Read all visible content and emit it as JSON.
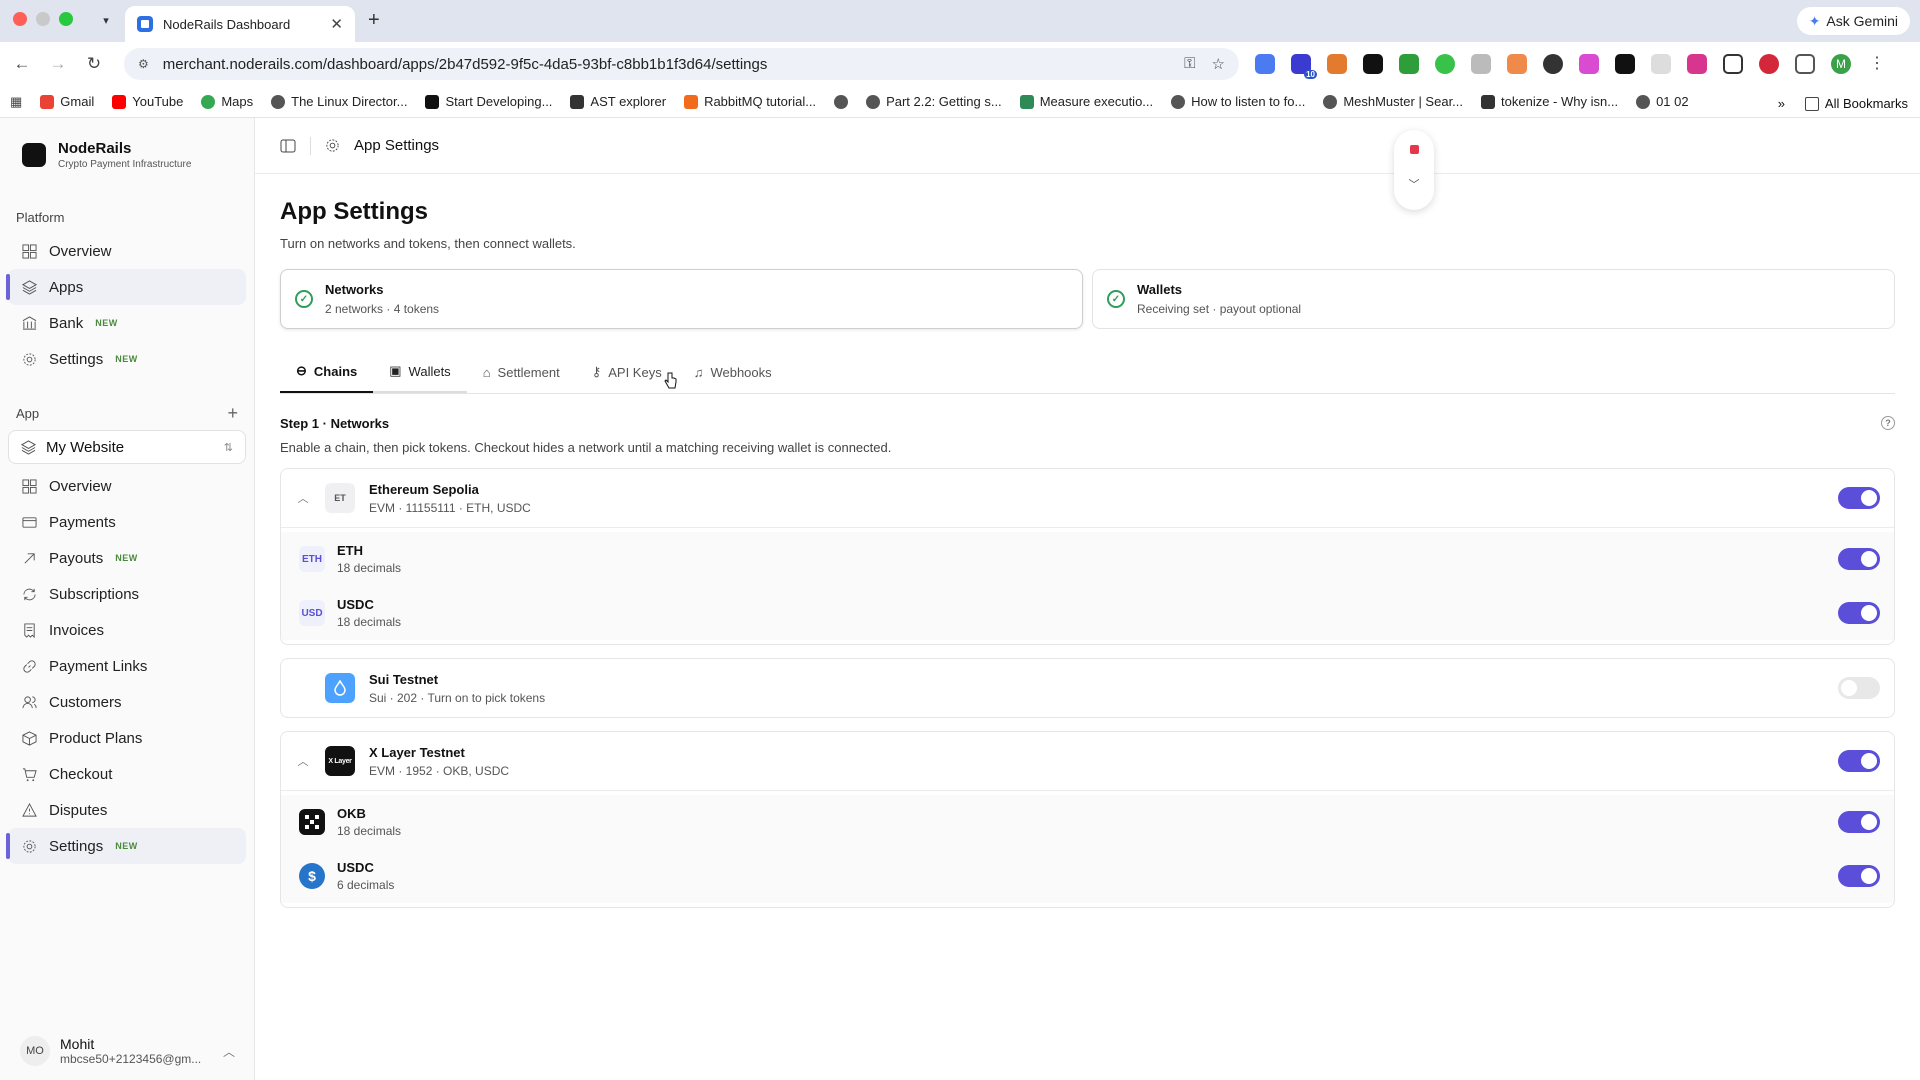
{
  "browser": {
    "tab_title": "NodeRails Dashboard",
    "url": "merchant.noderails.com/dashboard/apps/2b47d592-9f5c-4da5-93bf-c8bb1b1f3d64/settings",
    "ask_gemini": "Ask Gemini",
    "bookmarks": [
      "Gmail",
      "YouTube",
      "Maps",
      "The Linux Director...",
      "Start Developing...",
      "AST explorer",
      "RabbitMQ tutorial...",
      "",
      "Part 2.2: Getting s...",
      "Measure executio...",
      "How to listen to fo...",
      "MeshMuster | Sear...",
      "tokenize - Why isn...",
      "01 02"
    ],
    "all_bookmarks": "All Bookmarks",
    "more": "»",
    "ext_badge": "10",
    "profile": "M"
  },
  "sidebar": {
    "brand_name": "NodeRails",
    "brand_sub": "Crypto Payment Infrastructure",
    "platform_label": "Platform",
    "platform_items": [
      {
        "label": "Overview",
        "badge": ""
      },
      {
        "label": "Apps",
        "badge": ""
      },
      {
        "label": "Bank",
        "badge": "NEW"
      },
      {
        "label": "Settings",
        "badge": "NEW"
      }
    ],
    "app_label": "App",
    "app_add": "+",
    "app_selected": "My Website",
    "app_items": [
      {
        "label": "Overview",
        "badge": ""
      },
      {
        "label": "Payments",
        "badge": ""
      },
      {
        "label": "Payouts",
        "badge": "NEW"
      },
      {
        "label": "Subscriptions",
        "badge": ""
      },
      {
        "label": "Invoices",
        "badge": ""
      },
      {
        "label": "Payment Links",
        "badge": ""
      },
      {
        "label": "Customers",
        "badge": ""
      },
      {
        "label": "Product Plans",
        "badge": ""
      },
      {
        "label": "Checkout",
        "badge": ""
      },
      {
        "label": "Disputes",
        "badge": ""
      },
      {
        "label": "Settings",
        "badge": "NEW"
      }
    ],
    "user": {
      "initials": "MO",
      "name": "Mohit",
      "email": "mbcse50+2123456@gm..."
    }
  },
  "header": {
    "breadcrumb": "App Settings"
  },
  "page": {
    "title": "App Settings",
    "description": "Turn on networks and tokens, then connect wallets.",
    "status_cards": [
      {
        "title": "Networks",
        "subtitle": "2 networks · 4 tokens"
      },
      {
        "title": "Wallets",
        "subtitle": "Receiving set · payout optional"
      }
    ],
    "tabs": [
      "Chains",
      "Wallets",
      "Settlement",
      "API Keys",
      "Webhooks"
    ],
    "step_title": "Step 1 · Networks",
    "step_desc": "Enable a chain, then pick tokens. Checkout hides a network until a matching receiving wallet is connected.",
    "help": "?",
    "chains": [
      {
        "name": "Ethereum Sepolia",
        "meta": "EVM · 11155111 · ETH, USDC",
        "logo": "ET",
        "enabled": true,
        "tokens": [
          {
            "symbol": "ETH",
            "decimals": "18 decimals",
            "logo": "ETH",
            "enabled": true
          },
          {
            "symbol": "USDC",
            "decimals": "18 decimals",
            "logo": "USD",
            "enabled": true
          }
        ]
      },
      {
        "name": "Sui Testnet",
        "meta": "Sui · 202 · Turn on to pick tokens",
        "logo": "",
        "enabled": false,
        "tokens": []
      },
      {
        "name": "X Layer Testnet",
        "meta": "EVM · 1952 · OKB, USDC",
        "logo": "X Layer",
        "enabled": true,
        "tokens": [
          {
            "symbol": "OKB",
            "decimals": "18 decimals",
            "logo": "",
            "enabled": true
          },
          {
            "symbol": "USDC",
            "decimals": "6 decimals",
            "logo": "$",
            "enabled": true
          }
        ]
      }
    ]
  },
  "colors": {
    "accent": "#5b4fd9",
    "success": "#2e9e5b",
    "badge": "#4b8a3e",
    "record": "#e5364c"
  }
}
